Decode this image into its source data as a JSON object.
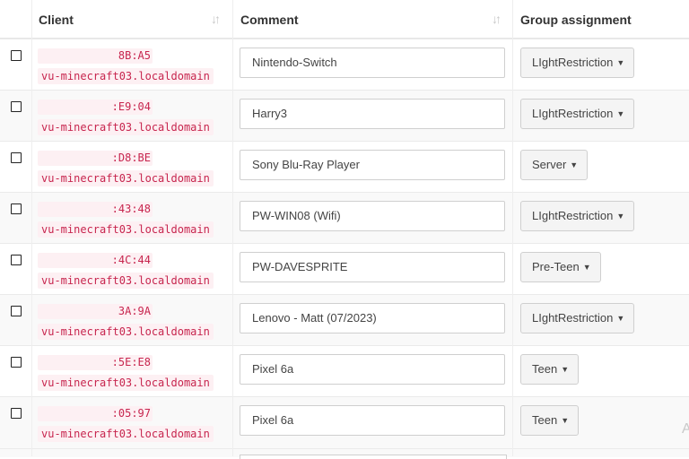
{
  "headers": {
    "client": "Client",
    "comment": "Comment",
    "group": "Group assignment"
  },
  "rows": [
    {
      "mac": "8B:A5",
      "host": "vu-minecraft03.localdomain",
      "comment": "Nintendo-Switch",
      "group": "LIghtRestriction"
    },
    {
      "mac": ":E9:04",
      "host": "vu-minecraft03.localdomain",
      "comment": "Harry3",
      "group": "LIghtRestriction"
    },
    {
      "mac": ":D8:BE",
      "host": "vu-minecraft03.localdomain",
      "comment": "Sony Blu-Ray Player",
      "group": "Server"
    },
    {
      "mac": ":43:48",
      "host": "vu-minecraft03.localdomain",
      "comment": "PW-WIN08 (Wifi)",
      "group": "LIghtRestriction"
    },
    {
      "mac": ":4C:44",
      "host": "vu-minecraft03.localdomain",
      "comment": "PW-DAVESPRITE",
      "group": "Pre-Teen"
    },
    {
      "mac": "3A:9A",
      "host": "vu-minecraft03.localdomain",
      "comment": "Lenovo - Matt (07/2023)",
      "group": "LIghtRestriction"
    },
    {
      "mac": ":5E:E8",
      "host": "vu-minecraft03.localdomain",
      "comment": "Pixel 6a",
      "group": "Teen"
    },
    {
      "mac": ":05:97",
      "host": "vu-minecraft03.localdomain",
      "comment": "Pixel 6a",
      "group": "Teen"
    }
  ],
  "icons": {
    "sort": "sort-arrows-icon",
    "caret": "caret-down-icon"
  },
  "colors": {
    "code_text": "#c7254e",
    "code_bg": "#fdf0f3",
    "stripe": "#f9f9f9"
  },
  "ghost_letter": "A"
}
